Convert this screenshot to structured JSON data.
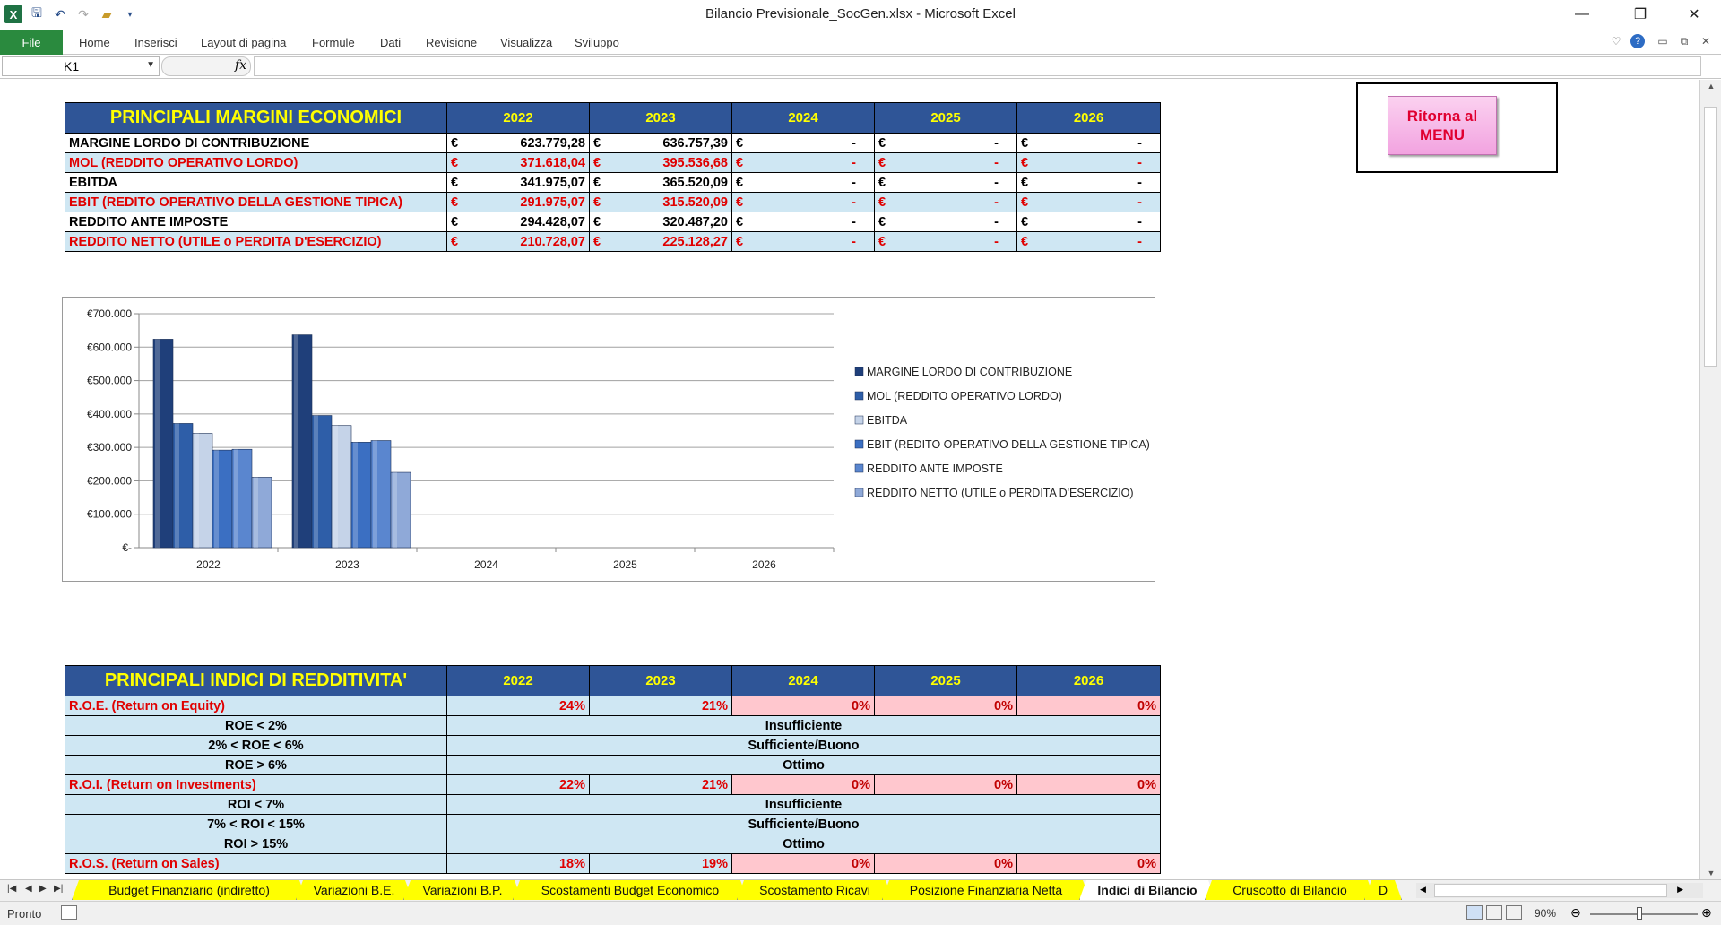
{
  "window": {
    "title": "Bilancio Previsionale_SocGen.xlsx  -  Microsoft Excel",
    "minimize": "—",
    "restore": "❐",
    "close": "✕"
  },
  "ribbon": {
    "file_tab": "File",
    "tabs": [
      "Home",
      "Inserisci",
      "Layout di pagina",
      "Formule",
      "Dati",
      "Revisione",
      "Visualizza",
      "Sviluppo"
    ]
  },
  "formula_bar": {
    "name_box": "K1",
    "fx": "fx",
    "formula": ""
  },
  "menu_button": {
    "label": "Ritorna al MENU"
  },
  "margini": {
    "title": "PRINCIPALI MARGINI ECONOMICI",
    "years": [
      "2022",
      "2023",
      "2024",
      "2025",
      "2026"
    ],
    "currency": "€",
    "rows": [
      {
        "label": "MARGINE LORDO DI CONTRIBUZIONE",
        "color": "black",
        "values": [
          "623.779,28",
          "636.757,39",
          "-",
          "-",
          "-"
        ]
      },
      {
        "label": "MOL (REDDITO OPERATIVO LORDO)",
        "color": "red",
        "values": [
          "371.618,04",
          "395.536,68",
          "-",
          "-",
          "-"
        ]
      },
      {
        "label": "EBITDA",
        "color": "black",
        "values": [
          "341.975,07",
          "365.520,09",
          "-",
          "-",
          "-"
        ]
      },
      {
        "label": "EBIT (REDITO OPERATIVO DELLA GESTIONE TIPICA)",
        "color": "red",
        "values": [
          "291.975,07",
          "315.520,09",
          "-",
          "-",
          "-"
        ]
      },
      {
        "label": "REDDITO ANTE IMPOSTE",
        "color": "black",
        "values": [
          "294.428,07",
          "320.487,20",
          "-",
          "-",
          "-"
        ]
      },
      {
        "label": "REDDITO NETTO (UTILE o PERDITA D'ESERCIZIO)",
        "color": "red",
        "values": [
          "210.728,07",
          "225.128,27",
          "-",
          "-",
          "-"
        ]
      }
    ]
  },
  "chart_data": {
    "type": "bar",
    "categories": [
      "2022",
      "2023",
      "2024",
      "2025",
      "2026"
    ],
    "ylim": [
      0,
      700000
    ],
    "yticks": [
      "€-",
      "€100.000",
      "€200.000",
      "€300.000",
      "€400.000",
      "€500.000",
      "€600.000",
      "€700.000"
    ],
    "legend_position": "right",
    "grid": true,
    "series": [
      {
        "name": "MARGINE LORDO DI CONTRIBUZIONE",
        "color": "#1f3f7a",
        "values": [
          623779.28,
          636757.39,
          0,
          0,
          0
        ]
      },
      {
        "name": "MOL (REDDITO OPERATIVO LORDO)",
        "color": "#2e5ea8",
        "values": [
          371618.04,
          395536.68,
          0,
          0,
          0
        ]
      },
      {
        "name": "EBITDA",
        "color": "#c5d3e8",
        "values": [
          341975.07,
          365520.09,
          0,
          0,
          0
        ]
      },
      {
        "name": "EBIT (REDITO OPERATIVO DELLA GESTIONE TIPICA)",
        "color": "#3b6fc2",
        "values": [
          291975.07,
          315520.09,
          0,
          0,
          0
        ]
      },
      {
        "name": "REDDITO ANTE IMPOSTE",
        "color": "#5a86cf",
        "values": [
          294428.07,
          320487.2,
          0,
          0,
          0
        ]
      },
      {
        "name": "REDDITO NETTO (UTILE o PERDITA D'ESERCIZIO)",
        "color": "#8fa9d8",
        "values": [
          210728.07,
          225128.27,
          0,
          0,
          0
        ]
      }
    ]
  },
  "redditivita": {
    "title": "PRINCIPALI INDICI DI REDDITIVITA'",
    "years": [
      "2022",
      "2023",
      "2024",
      "2025",
      "2026"
    ],
    "sections": [
      {
        "label": "R.O.E. (Return on Equity)",
        "values": [
          "24%",
          "21%",
          "0%",
          "0%",
          "0%"
        ],
        "bands": [
          {
            "range": "ROE < 2%",
            "judgement": "Insufficiente"
          },
          {
            "range": "2% < ROE < 6%",
            "judgement": "Sufficiente/Buono"
          },
          {
            "range": "ROE > 6%",
            "judgement": "Ottimo"
          }
        ]
      },
      {
        "label": "R.O.I. (Return on Investments)",
        "values": [
          "22%",
          "21%",
          "0%",
          "0%",
          "0%"
        ],
        "bands": [
          {
            "range": "ROI < 7%",
            "judgement": "Insufficiente"
          },
          {
            "range": "7% < ROI < 15%",
            "judgement": "Sufficiente/Buono"
          },
          {
            "range": "ROI > 15%",
            "judgement": "Ottimo"
          }
        ]
      },
      {
        "label": "R.O.S. (Return on Sales)",
        "values": [
          "18%",
          "19%",
          "0%",
          "0%",
          "0%"
        ],
        "bands": []
      }
    ]
  },
  "sheet_tabs": {
    "tabs": [
      "Budget Finanziario (indiretto)",
      "Variazioni B.E.",
      "Variazioni B.P.",
      "Scostamenti Budget Economico",
      "Scostamento Ricavi",
      "Posizione Finanziaria Netta",
      "Indici di Bilancio",
      "Cruscotto di Bilancio",
      "D"
    ],
    "active": "Indici di Bilancio"
  },
  "status": {
    "ready": "Pronto",
    "zoom": "90%"
  }
}
